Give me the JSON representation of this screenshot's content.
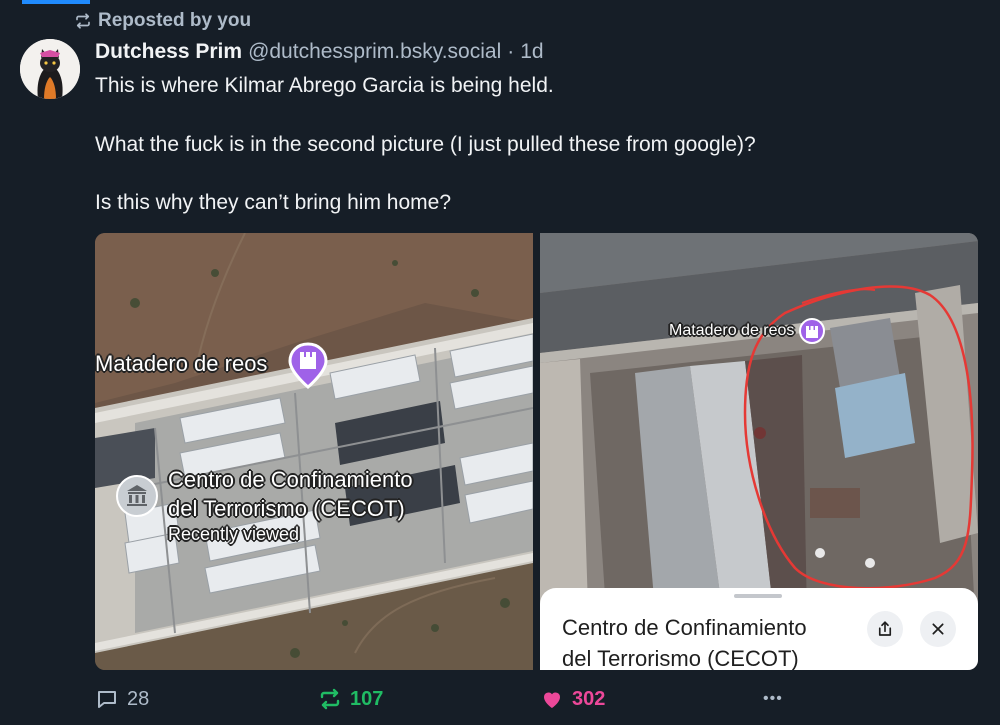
{
  "repost_label": "Reposted by you",
  "post": {
    "author_name": "Dutchess Prim",
    "author_handle": "@dutchessprim.bsky.social",
    "separator": "·",
    "time": "1d",
    "text_lines": [
      "This is where Kilmar Abrego Garcia is being held.",
      "What the fuck is in the second picture (I just pulled these from google)?",
      "Is this why they can’t bring him home?"
    ]
  },
  "images": {
    "left": {
      "pin_label": "Matadero de reos",
      "place_name_line1": "Centro de Confinamiento",
      "place_name_line2": "del Terrorismo (CECOT)",
      "place_status": "Recently viewed"
    },
    "right": {
      "pin_label": "Matadero de reos",
      "sheet_title_line1": "Centro de Confinamiento",
      "sheet_title_line2": "del Terrorismo (CECOT)"
    }
  },
  "actions": {
    "replies": "28",
    "reposts": "107",
    "likes": "302",
    "more": "•••"
  },
  "colors": {
    "background": "#161e27",
    "muted_text": "#aebbc9",
    "repost_active": "#20bc64",
    "like_active": "#ec4899",
    "map_pin": "#9f62e8",
    "red_marker_circle": "#e53935"
  },
  "icons": {
    "repost": "repost-icon",
    "reply": "reply-bubble-icon",
    "like": "heart-icon",
    "more": "more-icon",
    "pin": "castle-pin-icon",
    "place": "bank-building-icon",
    "share": "share-icon",
    "close": "close-icon"
  }
}
